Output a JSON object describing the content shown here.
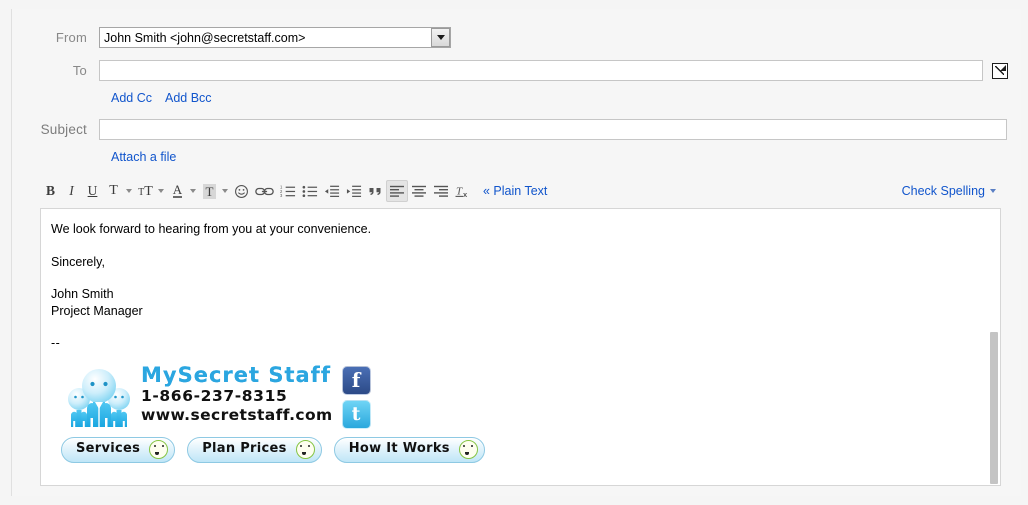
{
  "compose": {
    "fields": {
      "from": {
        "label": "From",
        "value": "John Smith <john@secretstaff.com>",
        "icon": "chevron-down-icon"
      },
      "to": {
        "label": "To",
        "value": "",
        "placeholder": "",
        "popout_icon": "expand-window-icon"
      },
      "subject": {
        "label": "Subject",
        "value": "",
        "placeholder": ""
      }
    },
    "links": {
      "add_cc": "Add Cc",
      "add_bcc": "Add Bcc",
      "attach_file": "Attach a file"
    }
  },
  "toolbar": {
    "buttons": [
      {
        "name": "bold-button",
        "label": "B",
        "icon": "bold-icon"
      },
      {
        "name": "italic-button",
        "label": "I",
        "icon": "italic-icon"
      },
      {
        "name": "underline-button",
        "label": "U",
        "icon": "underline-icon"
      },
      {
        "name": "font-family-button",
        "label": "T",
        "icon": "font-family-icon",
        "has_caret": true
      },
      {
        "name": "font-size-button",
        "label": "тT",
        "icon": "font-size-icon",
        "has_caret": true
      },
      {
        "name": "text-color-button",
        "label": "A",
        "icon": "text-color-icon",
        "has_caret": true
      },
      {
        "name": "highlight-color-button",
        "label": "T",
        "icon": "highlight-color-icon",
        "has_caret": true
      },
      {
        "name": "emoticon-button",
        "label": "",
        "icon": "smiley-icon"
      },
      {
        "name": "insert-link-button",
        "label": "",
        "icon": "link-icon"
      },
      {
        "name": "numbered-list-button",
        "label": "",
        "icon": "numbered-list-icon"
      },
      {
        "name": "bulleted-list-button",
        "label": "",
        "icon": "bulleted-list-icon"
      },
      {
        "name": "outdent-button",
        "label": "",
        "icon": "outdent-icon"
      },
      {
        "name": "indent-button",
        "label": "",
        "icon": "indent-icon"
      },
      {
        "name": "quote-button",
        "label": "",
        "icon": "quote-icon"
      },
      {
        "name": "align-left-button",
        "label": "",
        "icon": "align-left-icon",
        "active": true
      },
      {
        "name": "align-center-button",
        "label": "",
        "icon": "align-center-icon"
      },
      {
        "name": "align-right-button",
        "label": "",
        "icon": "align-right-icon"
      },
      {
        "name": "remove-formatting-button",
        "label": "",
        "icon": "remove-formatting-icon"
      }
    ],
    "plain_text_link": "« Plain Text",
    "check_spelling": "Check Spelling",
    "check_spelling_icon": "chevron-down-icon"
  },
  "body": {
    "lines": [
      "We look forward to hearing from you at your convenience.",
      "Sincerely,",
      "John Smith",
      "Project Manager"
    ],
    "line1": "We look forward to hearing from you at your convenience.",
    "line2": "Sincerely,",
    "line3": "John Smith",
    "line4": "Project Manager",
    "signature_separator": "--"
  },
  "signature": {
    "brand_name": "MySecret Staff",
    "phone": "1-866-237-8315",
    "website": "www.secretstaff.com",
    "mascot_icon": "people-group-icon",
    "social": [
      {
        "name": "facebook-icon",
        "glyph": "f"
      },
      {
        "name": "twitter-icon",
        "glyph": "t"
      }
    ],
    "buttons": [
      {
        "name": "services-button",
        "label": "Services"
      },
      {
        "name": "plan-prices-button",
        "label": "Plan Prices"
      },
      {
        "name": "how-it-works-button",
        "label": "How It Works"
      }
    ]
  },
  "colors": {
    "link": "#1155cc",
    "brand_cyan": "#2ba6e0",
    "facebook_blue": "#3b5998",
    "twitter_blue": "#4fc3f0"
  }
}
